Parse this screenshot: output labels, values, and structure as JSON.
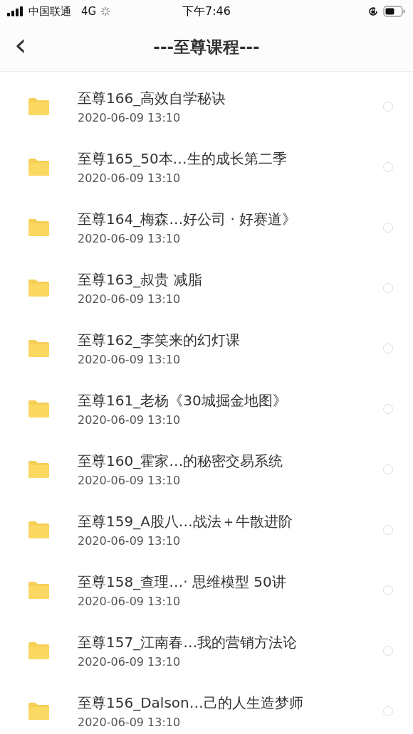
{
  "status_bar": {
    "carrier": "中国联通",
    "network": "4G",
    "time": "下午7:46"
  },
  "nav": {
    "back_icon": "‹",
    "title": "---至尊课程---"
  },
  "files": [
    {
      "name": "至尊166_高效自学秘诀",
      "date": "2020-06-09 13:10",
      "selected": false
    },
    {
      "name": "至尊165_50本…生的成长第二季",
      "date": "2020-06-09 13:10",
      "selected": false
    },
    {
      "name": "至尊164_梅森…好公司 · 好赛道》",
      "date": "2020-06-09 13:10",
      "selected": false
    },
    {
      "name": "至尊163_叔贵 减脂",
      "date": "2020-06-09 13:10",
      "selected": false
    },
    {
      "name": "至尊162_李笑来的幻灯课",
      "date": "2020-06-09 13:10",
      "selected": false
    },
    {
      "name": "至尊161_老杨《30城掘金地图》",
      "date": "2020-06-09 13:10",
      "selected": false
    },
    {
      "name": "至尊160_霍家…的秘密交易系统",
      "date": "2020-06-09 13:10",
      "selected": false
    },
    {
      "name": "至尊159_A股八…战法＋牛散进阶",
      "date": "2020-06-09 13:10",
      "selected": false
    },
    {
      "name": "至尊158_查理…· 思维模型 50讲",
      "date": "2020-06-09 13:10",
      "selected": false
    },
    {
      "name": "至尊157_江南春…我的营销方法论",
      "date": "2020-06-09 13:10",
      "selected": false
    },
    {
      "name": "至尊156_Dalson…己的人生造梦师",
      "date": "2020-06-09 13:10",
      "selected": false
    }
  ]
}
